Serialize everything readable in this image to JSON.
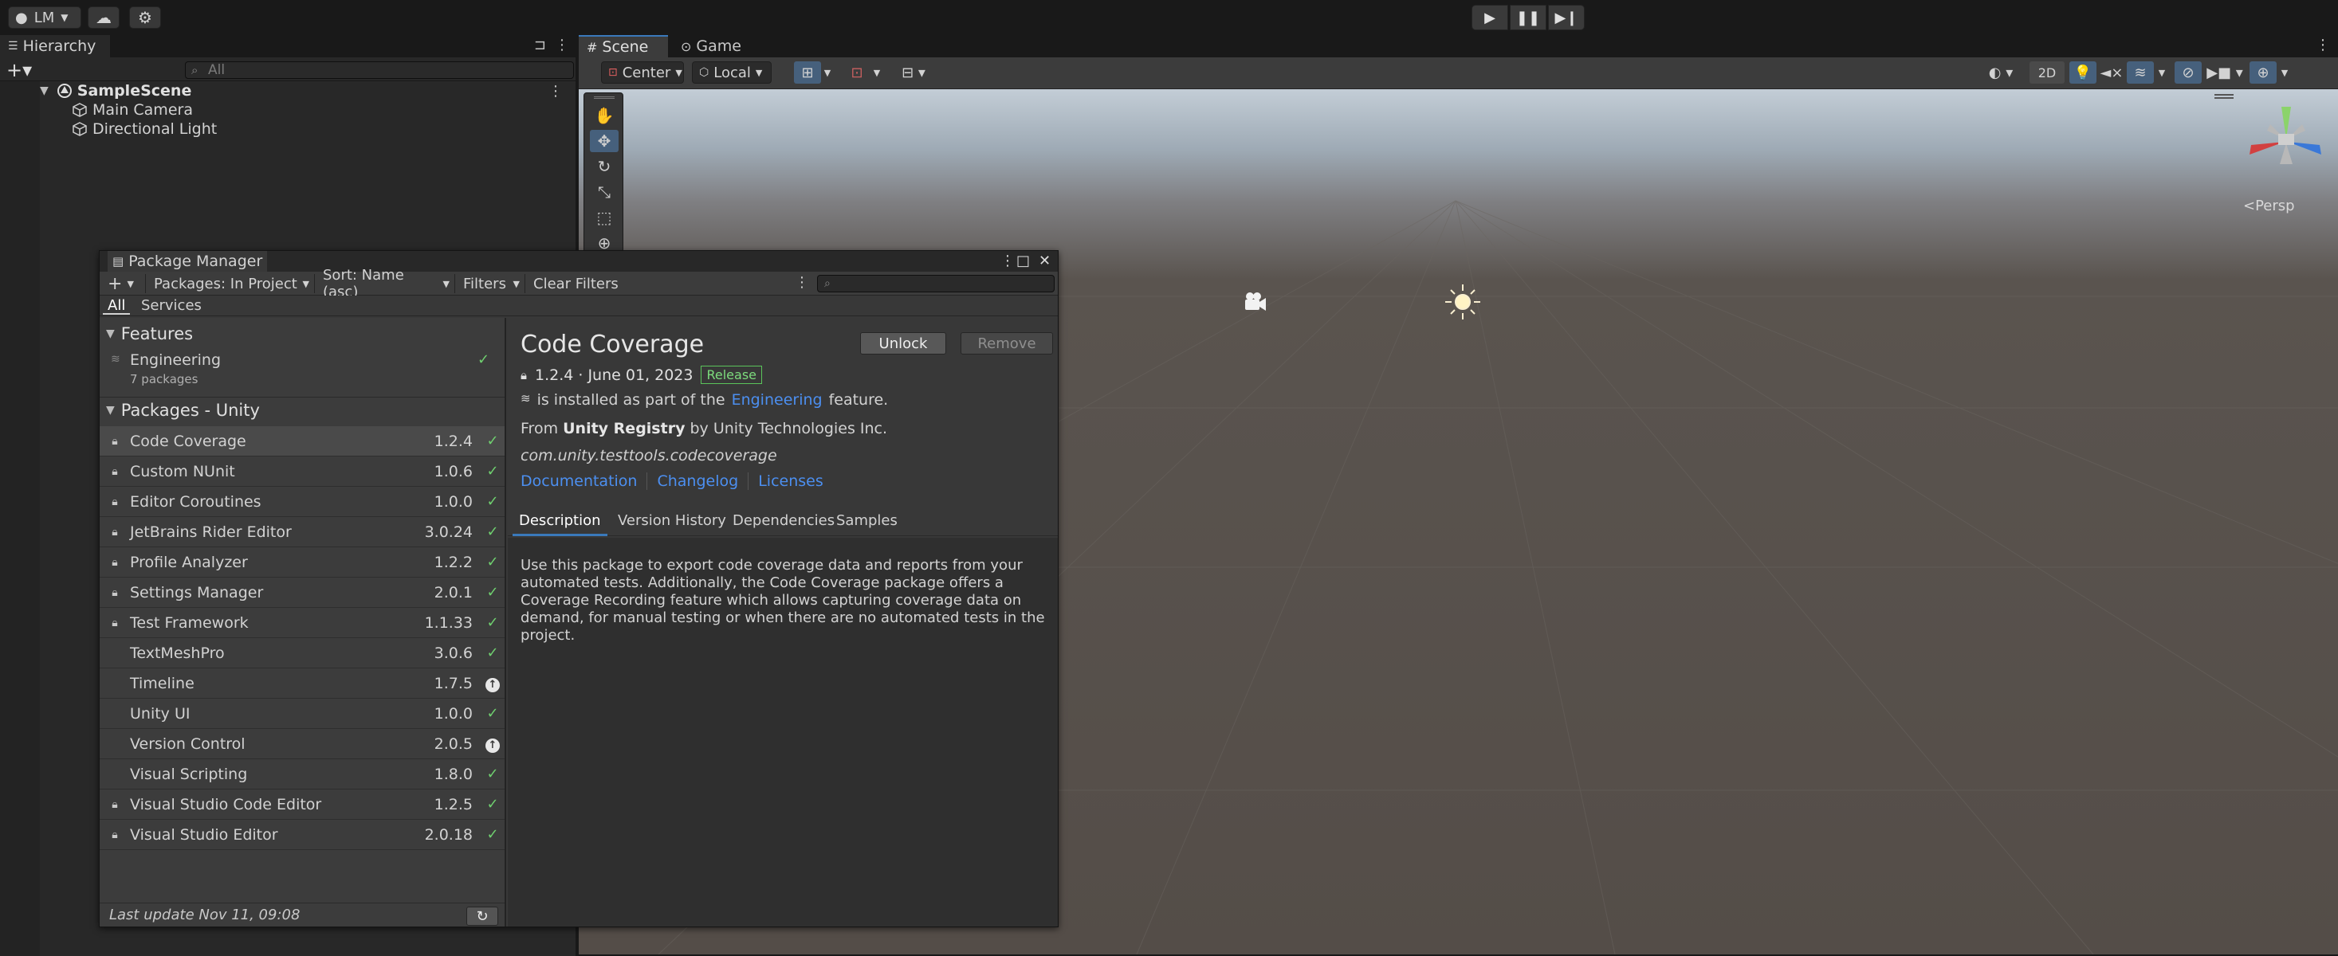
{
  "toolbar": {
    "account_label": "LM",
    "cloud_icon": "cloud-icon",
    "settings_icon": "gear-icon",
    "play_icons": [
      "play-icon",
      "pause-icon",
      "step-icon"
    ]
  },
  "hierarchy": {
    "tab_label": "Hierarchy",
    "search_placeholder": "All",
    "scene_name": "SampleScene",
    "items": [
      "Main Camera",
      "Directional Light"
    ]
  },
  "scene_view": {
    "tabs": [
      "Scene",
      "Game"
    ],
    "pivot_label": "Center",
    "space_label": "Local",
    "mode_2d_label": "2D",
    "persp_label": "Persp"
  },
  "package_manager": {
    "title": "Package Manager",
    "packages_dropdown": "Packages: In Project",
    "sort_dropdown": "Sort: Name (asc)",
    "filters_dropdown": "Filters",
    "clear_filters": "Clear Filters",
    "tabs": [
      "All",
      "Services"
    ],
    "features_header": "Features",
    "feature": {
      "name": "Engineering",
      "sub": "7 packages"
    },
    "packages_header": "Packages - Unity",
    "packages": [
      {
        "name": "Code Coverage",
        "version": "1.2.4",
        "locked": true,
        "status": "installed",
        "selected": true
      },
      {
        "name": "Custom NUnit",
        "version": "1.0.6",
        "locked": true,
        "status": "installed",
        "selected": false
      },
      {
        "name": "Editor Coroutines",
        "version": "1.0.0",
        "locked": true,
        "status": "installed",
        "selected": false
      },
      {
        "name": "JetBrains Rider Editor",
        "version": "3.0.24",
        "locked": true,
        "status": "installed",
        "selected": false
      },
      {
        "name": "Profile Analyzer",
        "version": "1.2.2",
        "locked": true,
        "status": "installed",
        "selected": false
      },
      {
        "name": "Settings Manager",
        "version": "2.0.1",
        "locked": true,
        "status": "installed",
        "selected": false
      },
      {
        "name": "Test Framework",
        "version": "1.1.33",
        "locked": true,
        "status": "installed",
        "selected": false
      },
      {
        "name": "TextMeshPro",
        "version": "3.0.6",
        "locked": false,
        "status": "installed",
        "selected": false
      },
      {
        "name": "Timeline",
        "version": "1.7.5",
        "locked": false,
        "status": "update",
        "selected": false
      },
      {
        "name": "Unity UI",
        "version": "1.0.0",
        "locked": false,
        "status": "installed",
        "selected": false
      },
      {
        "name": "Version Control",
        "version": "2.0.5",
        "locked": false,
        "status": "update",
        "selected": false
      },
      {
        "name": "Visual Scripting",
        "version": "1.8.0",
        "locked": false,
        "status": "installed",
        "selected": false
      },
      {
        "name": "Visual Studio Code Editor",
        "version": "1.2.5",
        "locked": true,
        "status": "installed",
        "selected": false
      },
      {
        "name": "Visual Studio Editor",
        "version": "2.0.18",
        "locked": true,
        "status": "installed",
        "selected": false
      }
    ],
    "last_update": "Last update Nov 11, 09:08",
    "detail": {
      "title": "Code Coverage",
      "unlock_label": "Unlock",
      "remove_label": "Remove",
      "version_date": "1.2.4 · June 01, 2023",
      "badge": "Release",
      "installed_prefix": "is installed as part of the",
      "installed_link": "Engineering",
      "installed_suffix": "feature.",
      "from_prefix": "From",
      "registry": "Unity Registry",
      "by": "by Unity Technologies Inc.",
      "package_id": "com.unity.testtools.codecoverage",
      "links": [
        "Documentation",
        "Changelog",
        "Licenses"
      ],
      "tabs": [
        "Description",
        "Version History",
        "Dependencies",
        "Samples"
      ],
      "description": "Use this package to export code coverage data and reports from your automated tests. Additionally, the Code Coverage package offers a Coverage Recording feature which allows capturing coverage data on demand, for manual testing or when there are no automated tests in the project."
    }
  }
}
